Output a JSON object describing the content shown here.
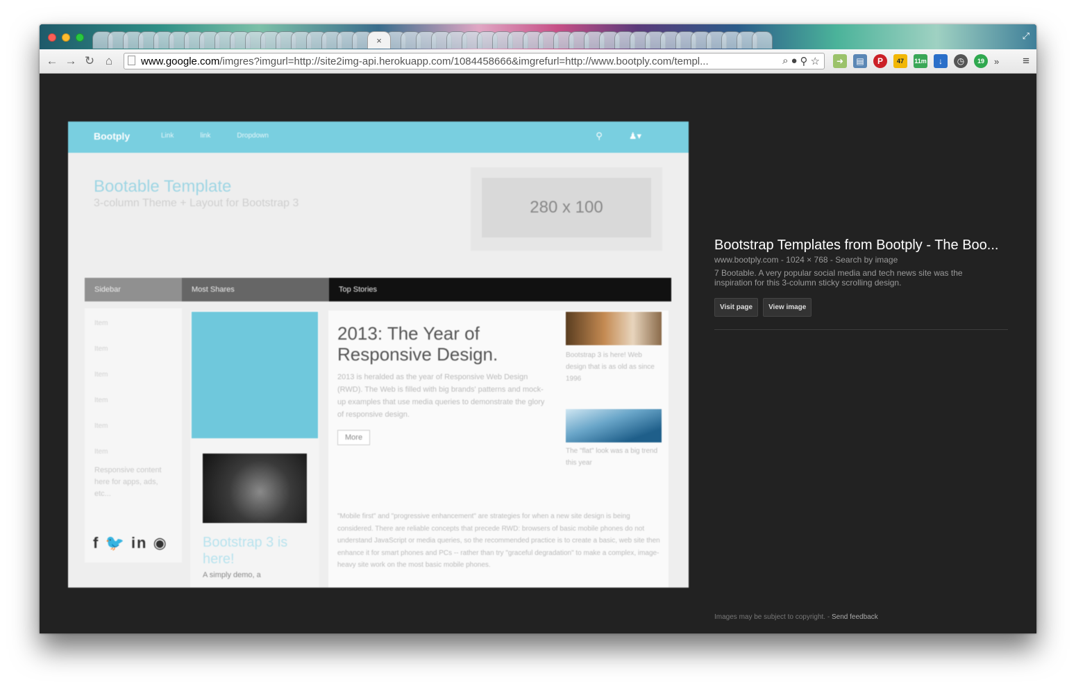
{
  "browser": {
    "active_tab_close": "×",
    "url_host": "www.google.com",
    "url_rest": "/imgres?imgurl=http://site2img-api.herokuapp.com/1084458666&imgrefurl=http://www.bootply.com/templ...",
    "ext_badge_weather": "47",
    "ext_badge_timer": "11m",
    "ext_badge_green": "19",
    "overflow": "»"
  },
  "preview": {
    "brand": "Bootply",
    "nav_links": [
      "Link",
      "link",
      "Dropdown"
    ],
    "title": "Bootable Template",
    "subtitle": "3-column Theme + Layout for Bootstrap 3",
    "ad_label": "280 x 100",
    "tabs": [
      "Sidebar",
      "Most Shares",
      "Top Stories"
    ],
    "sidebar_items": [
      "Item",
      "Item",
      "Item",
      "Item",
      "Item",
      "Item"
    ],
    "sidebar_text": "Responsive content here for apps, ads, etc...",
    "social": "f  in",
    "card_title": "Bootstrap 3 is here!",
    "card_text": "A simply demo, a",
    "article_title": "2013: The Year of Responsive Design.",
    "article_text": "2013 is heralded as the year of Responsive Web Design (RWD). The Web is filled with big brands' patterns and mock-up examples that use media queries to demonstrate the glory of responsive design.",
    "more": "More",
    "thumb1_text": "Bootstrap 3 is here! Web design that is as old as since 1996",
    "thumb2_text": "The \"flat\" look was a big trend this year",
    "bottom_text": "\"Mobile first\" and \"progressive enhancement\" are strategies for when a new site design is being considered. There are reliable concepts that precede RWD: browsers of basic mobile phones do not understand JavaScript or media queries, so the recommended practice is to create a basic, web site then enhance it for smart phones and PCs -- rather than try \"graceful degradation\" to make a complex, image-heavy site work on the most basic mobile phones."
  },
  "info": {
    "title": "Bootstrap Templates from Bootply - The Boo...",
    "source": "www.bootply.com",
    "dimensions": "1024 × 768",
    "search_by_image": "Search by image",
    "separator": " - ",
    "description": "7 Bootable. A very popular social media and tech news site was the inspiration for this 3-column sticky scrolling design.",
    "visit_page": "Visit page",
    "view_image": "View image"
  },
  "footer": {
    "copyright": "Images may be subject to copyright.",
    "separator": " - ",
    "feedback": "Send feedback"
  },
  "colors": {
    "background": "#222222",
    "preview_nav": "#79cfe0",
    "button_bg": "#333333"
  }
}
